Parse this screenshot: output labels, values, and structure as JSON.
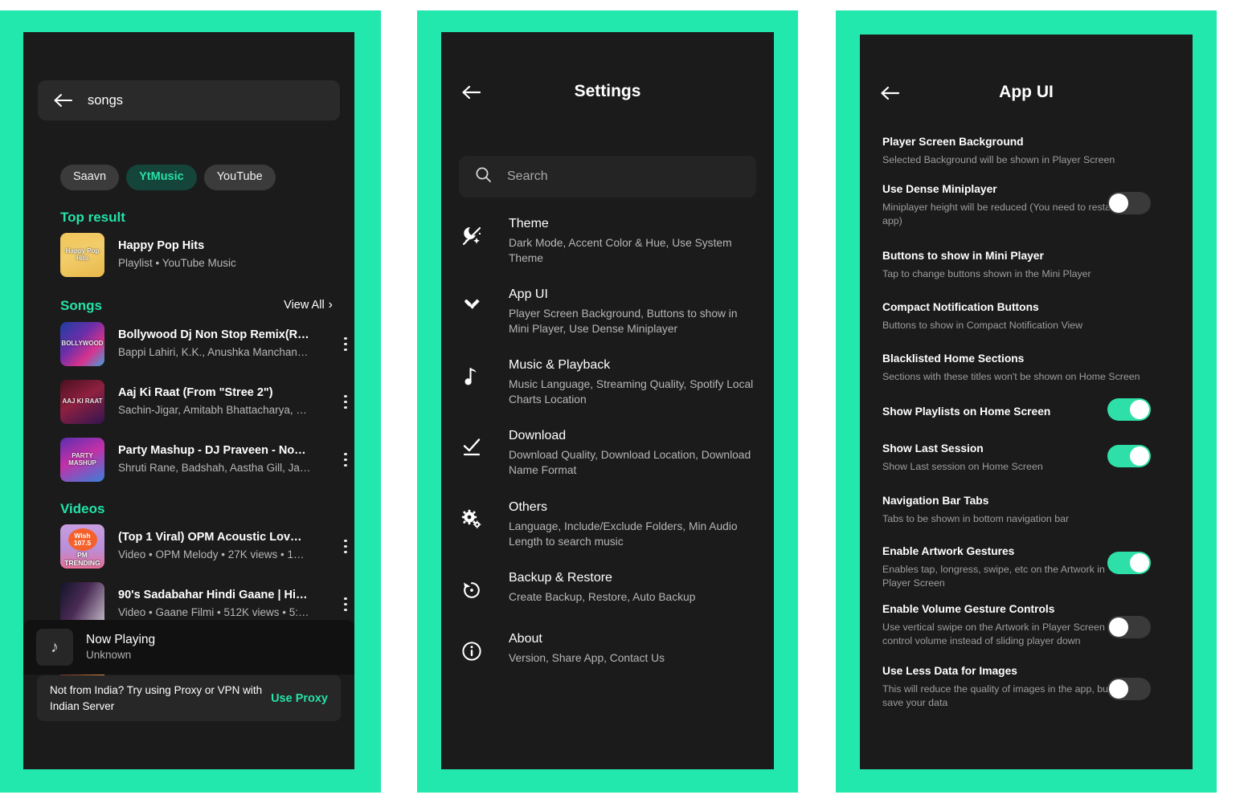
{
  "theme": {
    "accent": "#24e2a8",
    "frame_green": "#22e8ae",
    "panel_bg": "#1b1b1b"
  },
  "panel_search": {
    "search": {
      "value": "songs",
      "back_icon": "back-arrow-icon"
    },
    "chips": [
      {
        "label": "Saavn",
        "active": false
      },
      {
        "label": "YtMusic",
        "active": true
      },
      {
        "label": "YouTube",
        "active": false
      }
    ],
    "sections": {
      "top_result_label": "Top result",
      "songs_label": "Songs",
      "videos_label": "Videos",
      "view_all_label": "View All"
    },
    "top_result": {
      "title": "Happy Pop Hits",
      "subtitle": "Playlist • YouTube Music",
      "art_caption": "Happy Pop Hits"
    },
    "songs": [
      {
        "title": "Bollywood Dj Non Stop Remix(R…",
        "subtitle": "Bappi Lahiri, K.K., Anushka Manchan…",
        "art_caption": "BOLLYWOOD"
      },
      {
        "title": "Aaj Ki Raat (From \"Stree 2\")",
        "subtitle": "Sachin-Jigar, Amitabh Bhattacharya, …",
        "art_caption": "AAJ KI RAAT"
      },
      {
        "title": "Party Mashup - DJ Praveen - No…",
        "subtitle": "Shruti Rane, Badshah, Aastha Gill, Ja…",
        "art_caption": "PARTY MASHUP"
      }
    ],
    "videos": [
      {
        "title": "(Top 1 Viral) OPM Acoustic Lov…",
        "subtitle": "Video • OPM Melody  • 27K views • 1…",
        "art_caption_1": "Wish",
        "art_caption_2": "107.5",
        "art_caption_3": "PM TRENDING"
      },
      {
        "title": "90's Sadabahar Hindi Gaane | Hi…",
        "subtitle": "Video • Gaane Filmi • 512K views • 5:…",
        "art_caption": ""
      }
    ],
    "now_playing": {
      "title": "Now Playing",
      "subtitle": "Unknown",
      "icon": "music-note-icon"
    },
    "proxy_toast": {
      "message": "Not from India? Try using Proxy or VPN with Indian Server",
      "action_label": "Use Proxy"
    }
  },
  "panel_settings": {
    "title": "Settings",
    "back_icon": "back-arrow-icon",
    "search_placeholder": "Search",
    "items": [
      {
        "icon": "theme-magic-icon",
        "title": "Theme",
        "subtitle": "Dark Mode, Accent Color & Hue, Use System Theme"
      },
      {
        "icon": "brush-pencil-icon",
        "title": "App UI",
        "subtitle": "Player Screen Background, Buttons to show in Mini Player, Use Dense Miniplayer"
      },
      {
        "icon": "music-note-icon",
        "title": "Music & Playback",
        "subtitle": "Music Language, Streaming Quality, Spotify Local Charts Location"
      },
      {
        "icon": "download-check-icon",
        "title": "Download",
        "subtitle": "Download Quality, Download Location, Download Name Format"
      },
      {
        "icon": "gears-icon",
        "title": "Others",
        "subtitle": "Language, Include/Exclude Folders, Min Audio Length to search music"
      },
      {
        "icon": "restore-icon",
        "title": "Backup & Restore",
        "subtitle": "Create Backup, Restore, Auto Backup"
      },
      {
        "icon": "info-icon",
        "title": "About",
        "subtitle": "Version, Share App, Contact Us"
      }
    ]
  },
  "panel_appui": {
    "title": "App UI",
    "back_icon": "back-arrow-icon",
    "items": [
      {
        "title": "Player Screen Background",
        "subtitle": "Selected Background will be shown in Player Screen",
        "has_toggle": false
      },
      {
        "title": "Use Dense Miniplayer",
        "subtitle": "Miniplayer height will be reduced (You need to restart app)",
        "has_toggle": true,
        "toggle_on": false
      },
      {
        "title": "Buttons to show in Mini Player",
        "subtitle": "Tap to change buttons shown in the Mini Player",
        "has_toggle": false
      },
      {
        "title": "Compact Notification Buttons",
        "subtitle": "Buttons to show in Compact Notification View",
        "has_toggle": false
      },
      {
        "title": "Blacklisted Home Sections",
        "subtitle": "Sections with these titles won't be shown on Home Screen",
        "has_toggle": false
      },
      {
        "title": "Show Playlists on Home Screen",
        "subtitle": "",
        "has_toggle": true,
        "toggle_on": true
      },
      {
        "title": "Show Last Session",
        "subtitle": "Show Last session on Home Screen",
        "has_toggle": true,
        "toggle_on": true
      },
      {
        "title": "Navigation Bar Tabs",
        "subtitle": "Tabs to be shown in bottom navigation bar",
        "has_toggle": false
      },
      {
        "title": "Enable Artwork Gestures",
        "subtitle": "Enables tap, longress, swipe, etc on the Artwork in Player Screen",
        "has_toggle": true,
        "toggle_on": true
      },
      {
        "title": "Enable Volume Gesture Controls",
        "subtitle": "Use vertical swipe on the Artwork in Player Screen to control volume instead of sliding player down",
        "has_toggle": true,
        "toggle_on": false
      },
      {
        "title": "Use Less Data for Images",
        "subtitle": "This will reduce the quality of images in the app, but will save your data",
        "has_toggle": true,
        "toggle_on": false
      }
    ]
  }
}
